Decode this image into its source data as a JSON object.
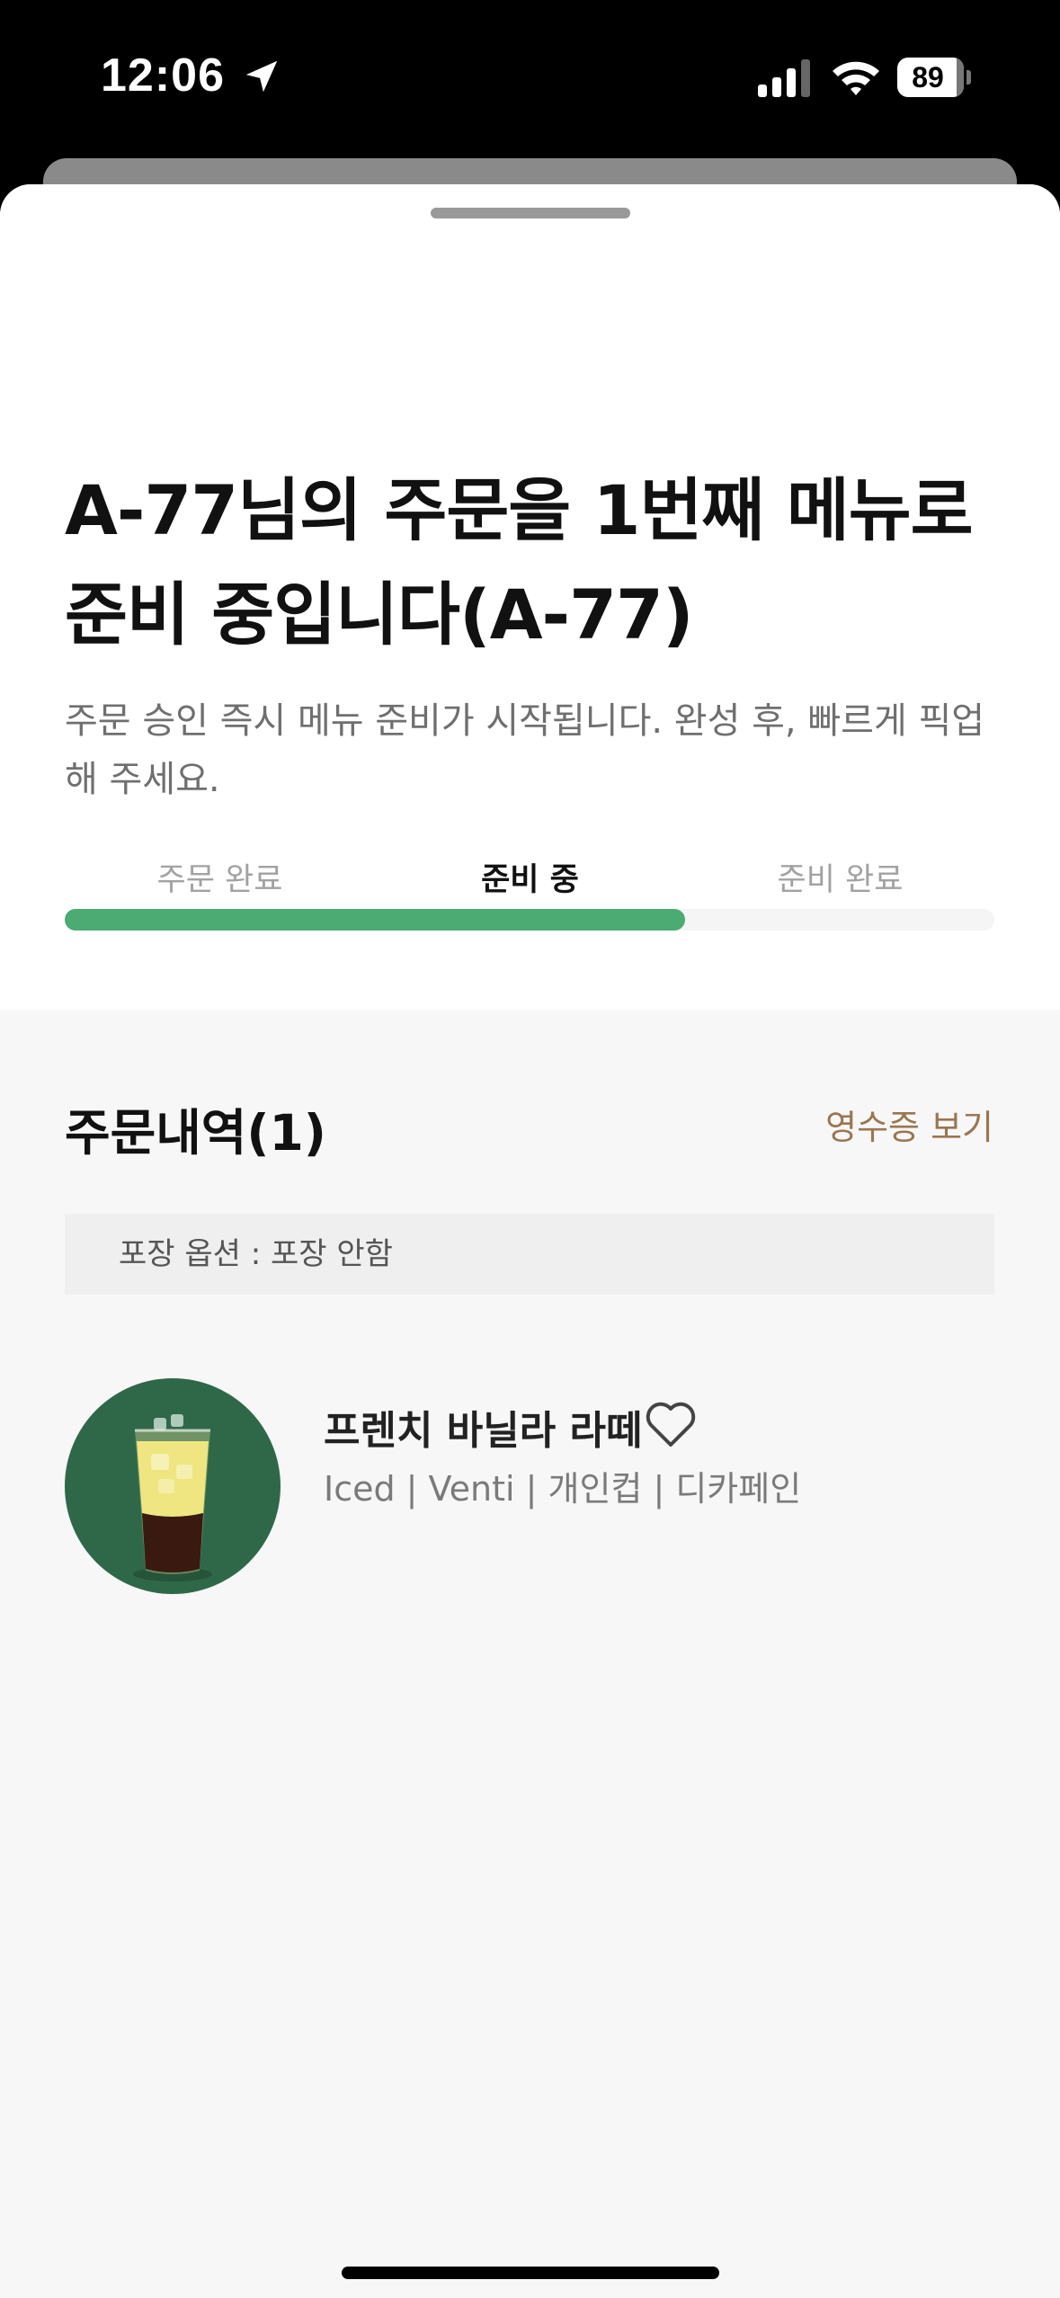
{
  "status_bar": {
    "time": "12:06",
    "battery": "89",
    "icons": [
      "location-arrow-icon",
      "cellular-signal-icon",
      "wifi-icon",
      "battery-icon"
    ]
  },
  "order_status": {
    "headline_line1": "A-77님의 주문을 1번째 메뉴로",
    "headline_line2": "준비 중입니다(A-77)",
    "description_line1": "주문 승인 즉시 메뉴 준비가 시작됩니다. 완성 후, 빠르게 픽업",
    "description_line2": "해 주세요.",
    "steps": [
      {
        "label": "주문 완료"
      },
      {
        "label": "준비 중",
        "active": true
      },
      {
        "label": "준비 완료"
      }
    ],
    "progress_fraction": 0.667,
    "accent_color": "#4bab72"
  },
  "order_details": {
    "title": "주문내역(1)",
    "receipt_link": "영수증 보기",
    "packaging_option": "포장 옵션 : 포장 안함",
    "items": [
      {
        "name": "프렌치 바닐라 라떼",
        "options": "Iced | Venti | 개인컵 | 디카페인",
        "image": "iced-vanilla-latte-image",
        "favorite_icon": "heart-outline-icon"
      }
    ]
  },
  "colors": {
    "brand_green": "#2f6849",
    "progress_green": "#4bab72",
    "link_brown": "#9a7651"
  }
}
